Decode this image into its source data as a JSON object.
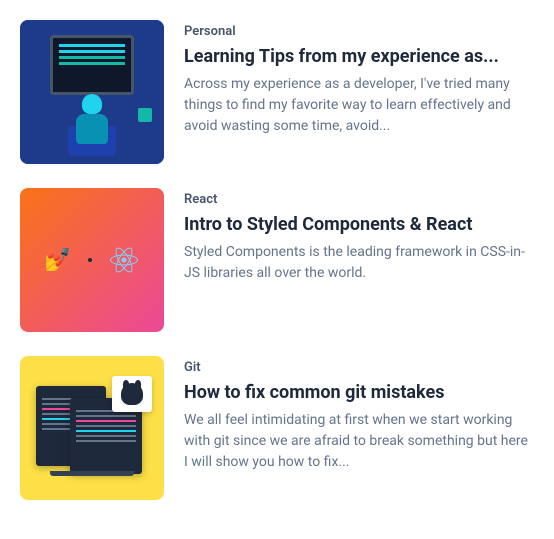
{
  "articles": [
    {
      "category": "Personal",
      "title": "Learning Tips from my experience as...",
      "description": "Across my experience as a developer, I've tried many things to find my favorite way to learn effectively and avoid wasting some time, avoid..."
    },
    {
      "category": "React",
      "title": "Intro to Styled Components & React",
      "description": "Styled Components is the leading framework in CSS-in-JS libraries all over the world."
    },
    {
      "category": "Git",
      "title": "How to fix common git mistakes",
      "description": "We all feel intimidating at first when we start working with git since we are afraid to break something but here I will show you how to fix..."
    }
  ]
}
